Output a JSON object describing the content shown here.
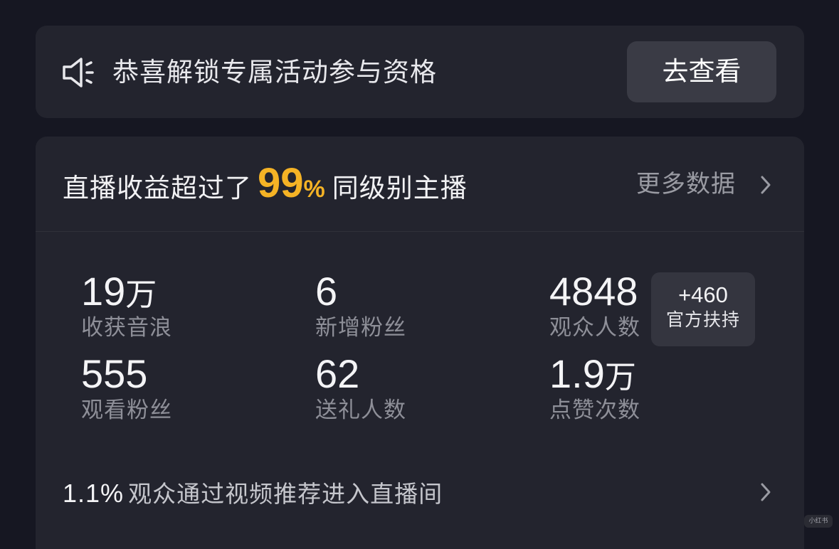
{
  "banner": {
    "icon": "speaker-icon",
    "text": "恭喜解锁专属活动参与资格",
    "button_label": "去查看"
  },
  "revenue": {
    "prefix": "直播收益超过了",
    "percent": "99",
    "percent_sign": "%",
    "suffix": "同级别主播",
    "more_label": "更多数据"
  },
  "stats": [
    {
      "value": "19",
      "unit": "万",
      "label": "收获音浪"
    },
    {
      "value": "6",
      "unit": "",
      "label": "新增粉丝"
    },
    {
      "value": "4848",
      "unit": "",
      "label": "观众人数"
    },
    {
      "value": "555",
      "unit": "",
      "label": "观看粉丝"
    },
    {
      "value": "62",
      "unit": "",
      "label": "送礼人数"
    },
    {
      "value": "1.9",
      "unit": "万",
      "label": "点赞次数"
    }
  ],
  "support_badge": {
    "value": "+460",
    "label": "官方扶持"
  },
  "recommend": {
    "percent": "1.1%",
    "text": "观众通过视频推荐进入直播间"
  },
  "watermark": "小红书",
  "colors": {
    "background": "#161722",
    "card": "#23242e",
    "accent": "#f5b325",
    "button": "#3a3b45",
    "muted": "#8e8f98"
  }
}
